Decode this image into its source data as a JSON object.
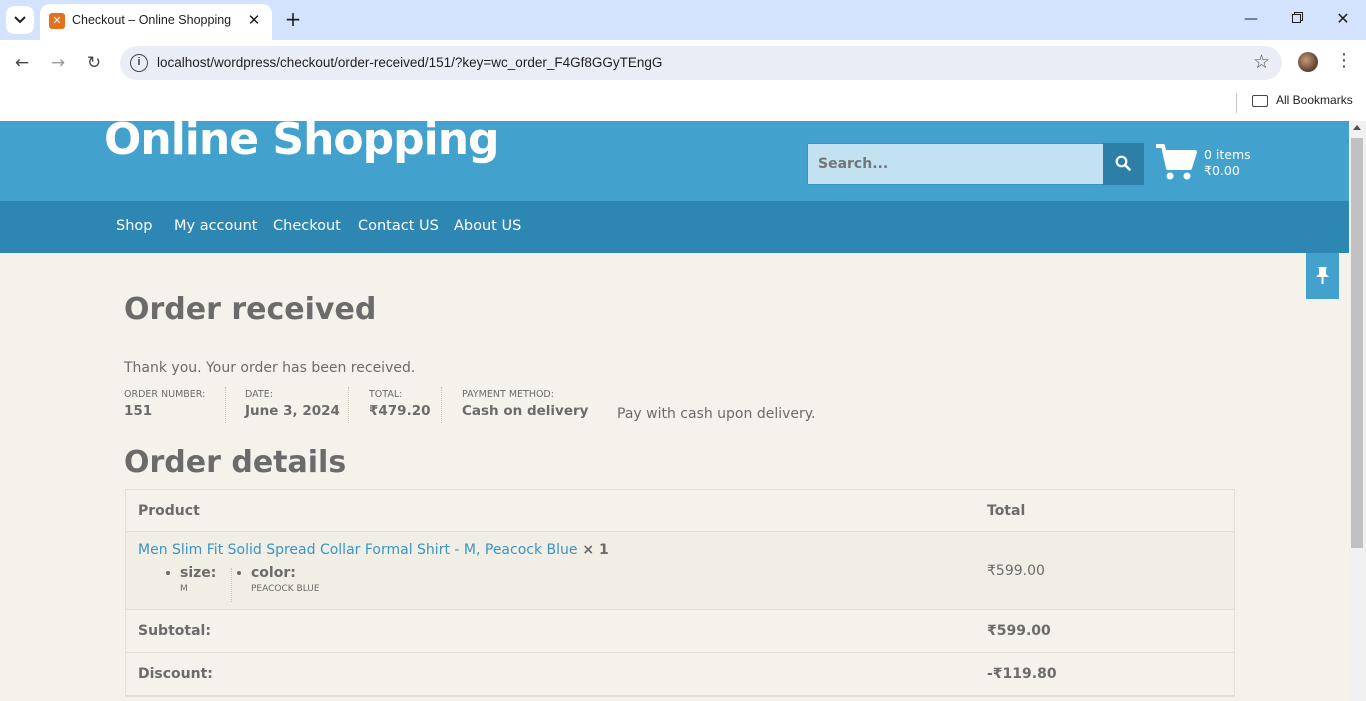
{
  "browser": {
    "tab_title": "Checkout – Online Shopping",
    "url": "localhost/wordpress/checkout/order-received/151/?key=wc_order_F4Gf8GGyTEngG",
    "bookmarks_label": "All Bookmarks"
  },
  "site": {
    "title": "Online Shopping",
    "search_placeholder": "Search...",
    "cart_items": "0 items",
    "cart_total": "₹0.00",
    "colors": {
      "header": "#43a1cd",
      "nav": "#2e86b2",
      "link": "#3c94c4"
    }
  },
  "nav": {
    "items": [
      "Shop",
      "My account",
      "Checkout",
      "Contact US",
      "About US"
    ]
  },
  "page": {
    "title": "Order received",
    "thank_you": "Thank you. Your order has been received.",
    "overview": [
      {
        "label": "ORDER NUMBER:",
        "value": "151"
      },
      {
        "label": "DATE:",
        "value": "June 3, 2024"
      },
      {
        "label": "TOTAL:",
        "value": "₹479.20"
      },
      {
        "label": "PAYMENT METHOD:",
        "value": "Cash on delivery"
      }
    ],
    "payment_note": "Pay with cash upon delivery.",
    "details_title": "Order details",
    "table": {
      "col_product": "Product",
      "col_total": "Total",
      "item": {
        "name": "Men Slim Fit Solid Spread Collar Formal Shirt - M, Peacock Blue",
        "qty": " × 1",
        "meta": [
          {
            "key": "size:",
            "value": "M"
          },
          {
            "key": "color:",
            "value": "PEACOCK BLUE"
          }
        ],
        "total": "₹599.00"
      },
      "subtotal_label": "Subtotal:",
      "subtotal_value": "₹599.00",
      "discount_label": "Discount:",
      "discount_value": "-₹119.80"
    }
  }
}
